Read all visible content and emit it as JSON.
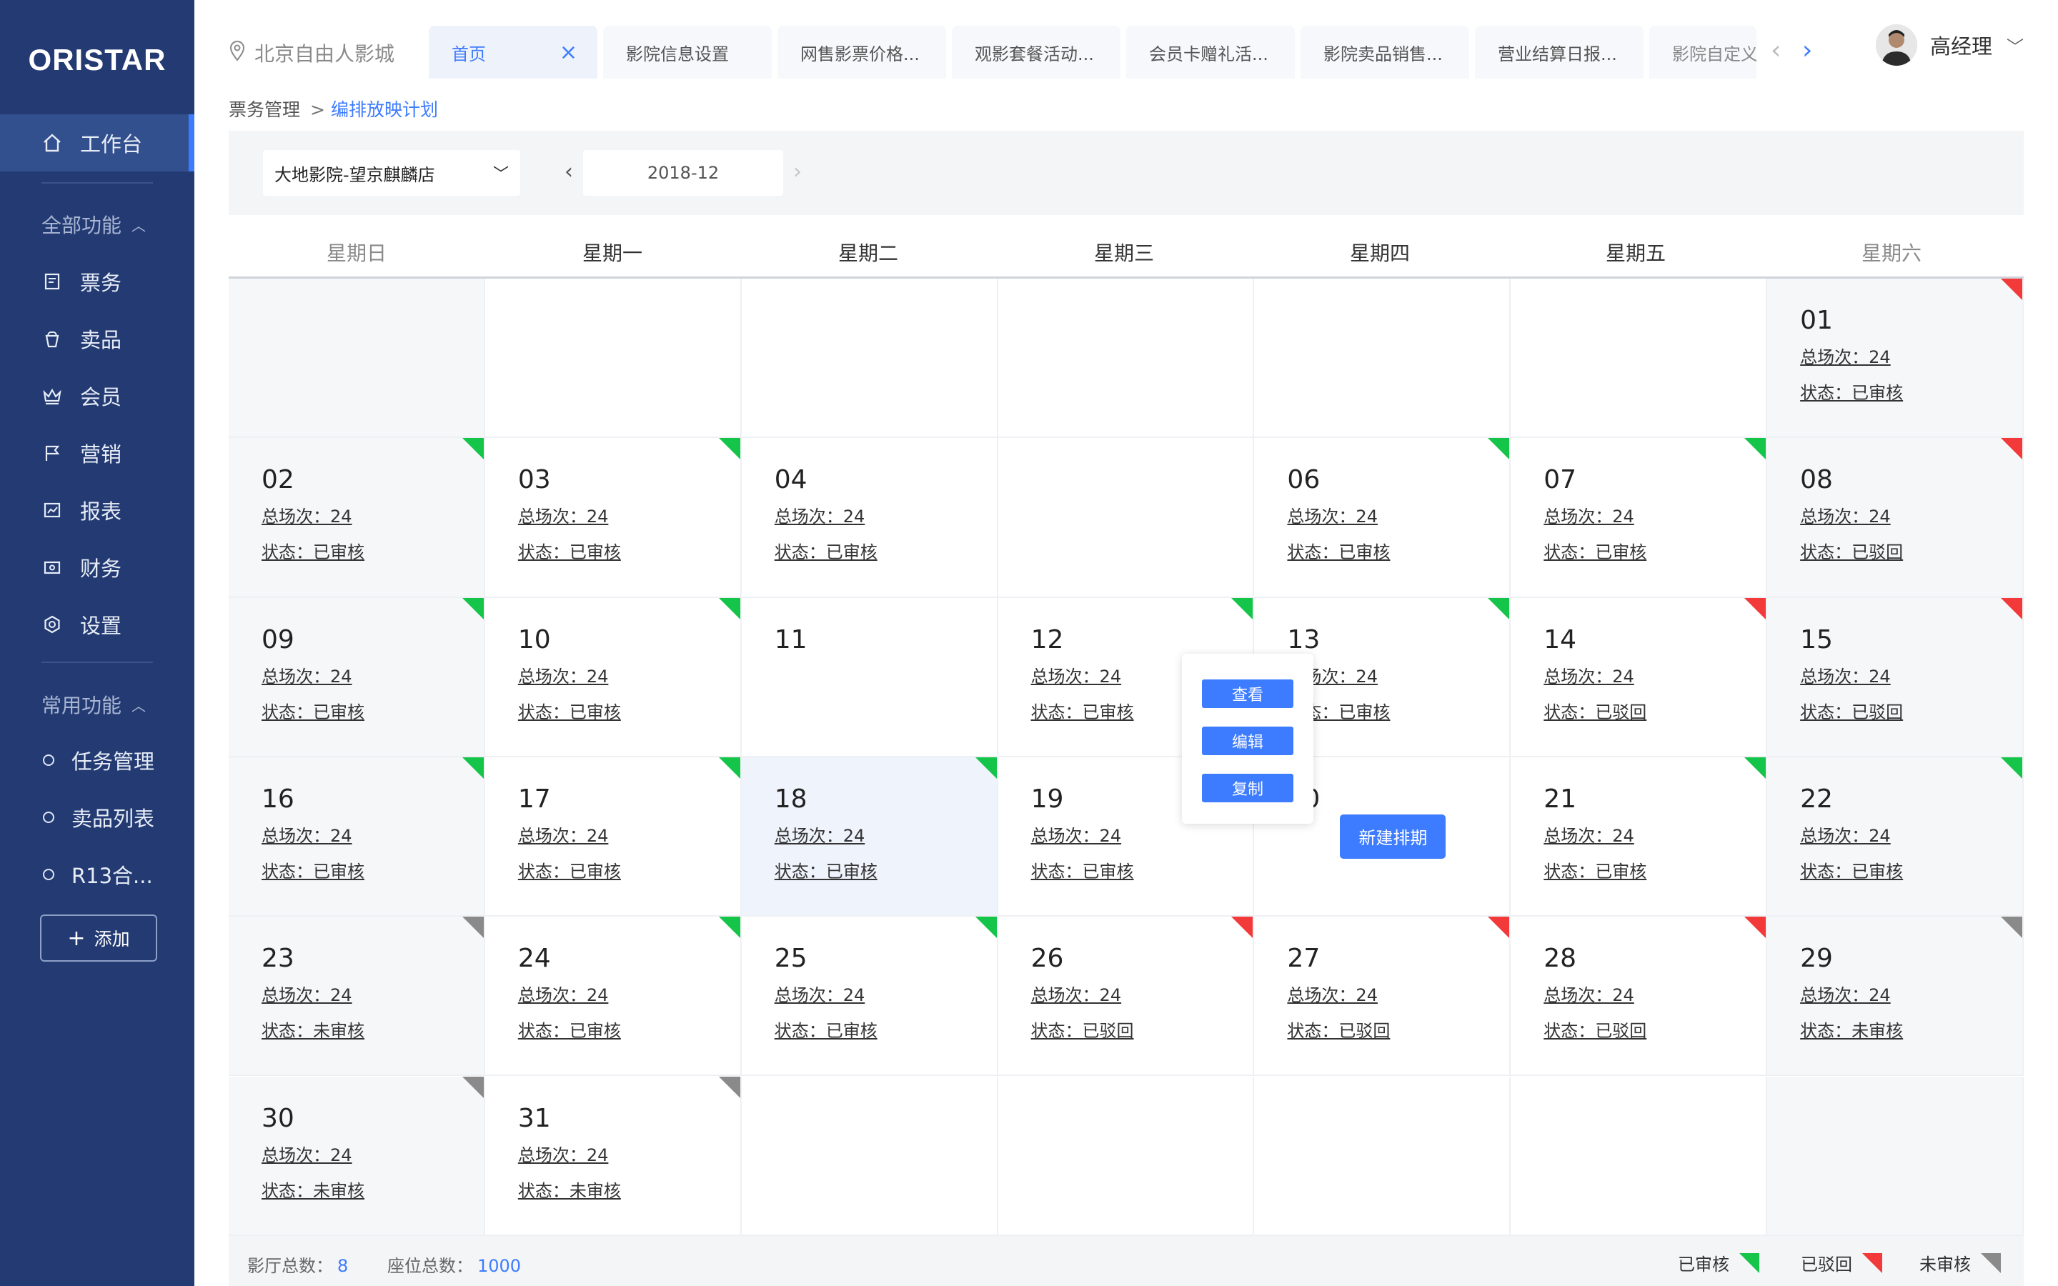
{
  "app": {
    "logo": "ORISTAR"
  },
  "sidebar": {
    "workbench": "工作台",
    "all_functions": "全部功能",
    "items": [
      "票务",
      "卖品",
      "会员",
      "营销",
      "报表",
      "财务",
      "设置"
    ],
    "common_functions": "常用功能",
    "common_items": [
      "任务管理",
      "卖品列表",
      "R13合..."
    ],
    "add_label": "添加"
  },
  "header": {
    "cinema": "北京自由人影城",
    "tabs": [
      "首页",
      "影院信息设置",
      "网售影票价格...",
      "观影套餐活动...",
      "会员卡赠礼活...",
      "影院卖品销售...",
      "营业结算日报...",
      "影院自定义义"
    ],
    "user": "高经理"
  },
  "breadcrumb": {
    "parent": "票务管理",
    "sep": ">",
    "current": "编排放映计划"
  },
  "filter": {
    "cinema_select": "大地影院-望京麒麟店",
    "month": "2018-12"
  },
  "weekdays": [
    "星期日",
    "星期一",
    "星期二",
    "星期三",
    "星期四",
    "星期五",
    "星期六"
  ],
  "calendar": {
    "colors": {
      "approved": "#15c54a",
      "rejected": "#f23a3a",
      "pending": "#8a8a8a"
    },
    "days": [
      {
        "d": "01",
        "tot": "总场次：24",
        "st": "状态：已审核",
        "flag": "red"
      },
      {
        "d": "02",
        "tot": "总场次：24",
        "st": "状态：已审核",
        "flag": "green"
      },
      {
        "d": "03",
        "tot": "总场次：24",
        "st": "状态：已审核",
        "flag": "green"
      },
      {
        "d": "04",
        "tot": "总场次：24",
        "st": "状态：已审核",
        "flag": ""
      },
      {
        "d": "",
        "tot": "",
        "st": "",
        "flag": ""
      },
      {
        "d": "06",
        "tot": "总场次：24",
        "st": "状态：已审核",
        "flag": "green"
      },
      {
        "d": "07",
        "tot": "总场次：24",
        "st": "状态：已审核",
        "flag": "green"
      },
      {
        "d": "08",
        "tot": "总场次：24",
        "st": "状态：已驳回",
        "flag": "red"
      },
      {
        "d": "09",
        "tot": "总场次：24",
        "st": "状态：已审核",
        "flag": "green"
      },
      {
        "d": "10",
        "tot": "总场次：24",
        "st": "状态：已审核",
        "flag": "green"
      },
      {
        "d": "11",
        "tot": "",
        "st": "",
        "flag": ""
      },
      {
        "d": "12",
        "tot": "总场次：24",
        "st": "状态：已审核",
        "flag": "green"
      },
      {
        "d": "13",
        "tot": "总场次：24",
        "st": "状态：已审核",
        "flag": "green"
      },
      {
        "d": "14",
        "tot": "总场次：24",
        "st": "状态：已驳回",
        "flag": "red"
      },
      {
        "d": "15",
        "tot": "总场次：24",
        "st": "状态：已驳回",
        "flag": "red"
      },
      {
        "d": "16",
        "tot": "总场次：24",
        "st": "状态：已审核",
        "flag": "green"
      },
      {
        "d": "17",
        "tot": "总场次：24",
        "st": "状态：已审核",
        "flag": "green"
      },
      {
        "d": "18",
        "tot": "总场次：24",
        "st": "状态：已审核",
        "flag": "green"
      },
      {
        "d": "19",
        "tot": "总场次：24",
        "st": "状态：已审核",
        "flag": "green"
      },
      {
        "d": "20",
        "tot": "",
        "st": "",
        "flag": "",
        "new": "新建排期"
      },
      {
        "d": "21",
        "tot": "总场次：24",
        "st": "状态：已审核",
        "flag": "green"
      },
      {
        "d": "22",
        "tot": "总场次：24",
        "st": "状态：已审核",
        "flag": "green"
      },
      {
        "d": "23",
        "tot": "总场次：24",
        "st": "状态：未审核",
        "flag": "gray"
      },
      {
        "d": "24",
        "tot": "总场次：24",
        "st": "状态：已审核",
        "flag": "green"
      },
      {
        "d": "25",
        "tot": "总场次：24",
        "st": "状态：已审核",
        "flag": "green"
      },
      {
        "d": "26",
        "tot": "总场次：24",
        "st": "状态：已驳回",
        "flag": "red"
      },
      {
        "d": "27",
        "tot": "总场次：24",
        "st": "状态：已驳回",
        "flag": "red"
      },
      {
        "d": "28",
        "tot": "总场次：24",
        "st": "状态：已驳回",
        "flag": "red"
      },
      {
        "d": "29",
        "tot": "总场次：24",
        "st": "状态：未审核",
        "flag": "gray"
      },
      {
        "d": "30",
        "tot": "总场次：24",
        "st": "状态：未审核",
        "flag": "gray"
      },
      {
        "d": "31",
        "tot": "总场次：24",
        "st": "状态：未审核",
        "flag": "gray"
      }
    ]
  },
  "popup": {
    "view": "查看",
    "edit": "编辑",
    "copy": "复制"
  },
  "footer": {
    "halls_label": "影厅总数：",
    "halls": "8",
    "seats_label": "座位总数：",
    "seats": "1000",
    "legend": [
      "已审核",
      "已驳回",
      "未审核"
    ]
  }
}
